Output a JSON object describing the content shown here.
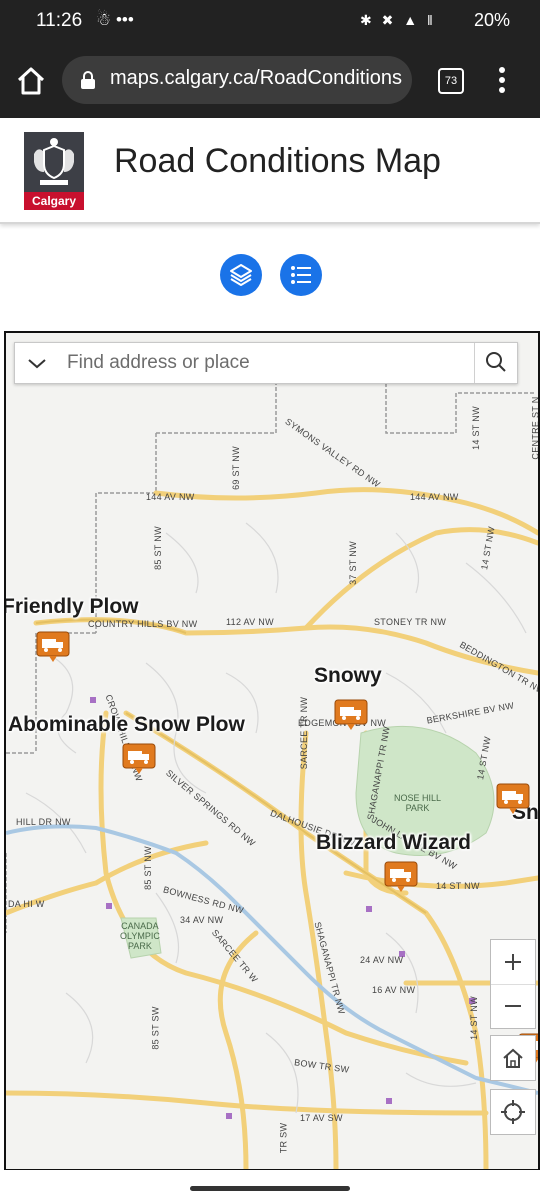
{
  "status": {
    "time": "11:26",
    "notif": "☃ •••",
    "signal": "✱ ✖ ▲ ‖",
    "battery": "20%"
  },
  "browser": {
    "url": "maps.calgary.ca/RoadConditions",
    "tab_count": "73"
  },
  "header": {
    "logo_text": "Calgary",
    "title": "Road Conditions Map"
  },
  "search": {
    "placeholder": "Find address or place"
  },
  "plows": [
    {
      "name": "Friendly Plow"
    },
    {
      "name": "Snowy"
    },
    {
      "name": "Abominable Snow Plow"
    },
    {
      "name": "Blizzard Wizard"
    },
    {
      "name": "Sn"
    }
  ],
  "roads": {
    "r144": "144 AV NW",
    "r144b": "144 AV NW",
    "r69": "69 ST NW",
    "r85": "85 ST NW",
    "r14a": "14 ST NW",
    "r14b": "14 ST NW",
    "rcentre": "CENTRE ST N",
    "rsymons": "SYMONS VALLEY RD NW",
    "r37": "37 ST NW",
    "rch": "COUNTRY HILLS BV NW",
    "r112": "112 AV NW",
    "rstoney": "STONEY TR NW",
    "rbedd": "BEDDINGTON TR NW",
    "rberk": "BERKSHIRE BV NW",
    "rsarcee": "SARCEE TR NW",
    "redge": "EDGEMONT BV NW",
    "rshag": "SHAGANAPPI TR NW",
    "rcrow": "CROWCHILD TR NW",
    "rsilver": "SILVER SPRINGS RD NW",
    "rdal": "DALHOUSIE DR NW",
    "rjohn": "JOHN LAURIE BV NW",
    "rhill": "HILL DR NW",
    "rtrans": "DA HI W",
    "r85b": "85 ST NW",
    "rbow": "BOWNESS RD NW",
    "r34": "34 AV NW",
    "rsarcee2": "SARCEE TR W",
    "rshag2": "SHAGANAPPI TR NW",
    "r24": "24 AV NW",
    "r16": "16 AV NW",
    "r14c": "14 ST NW",
    "r85c": "85 ST SW",
    "rbowtr": "BOW TR SW",
    "r17": "17 AV SW",
    "r14d": "14 ST NW",
    "rsw": "TR SW",
    "r14e": "14 ST NW"
  },
  "parks": {
    "nosehill": "NOSE HILL\nPARK",
    "olympic": "CANADA\nOLYMPIC\nPARK"
  },
  "colors": {
    "accent": "#1a73e8",
    "plow": "#e07a1f",
    "brand": "#c8102e"
  }
}
